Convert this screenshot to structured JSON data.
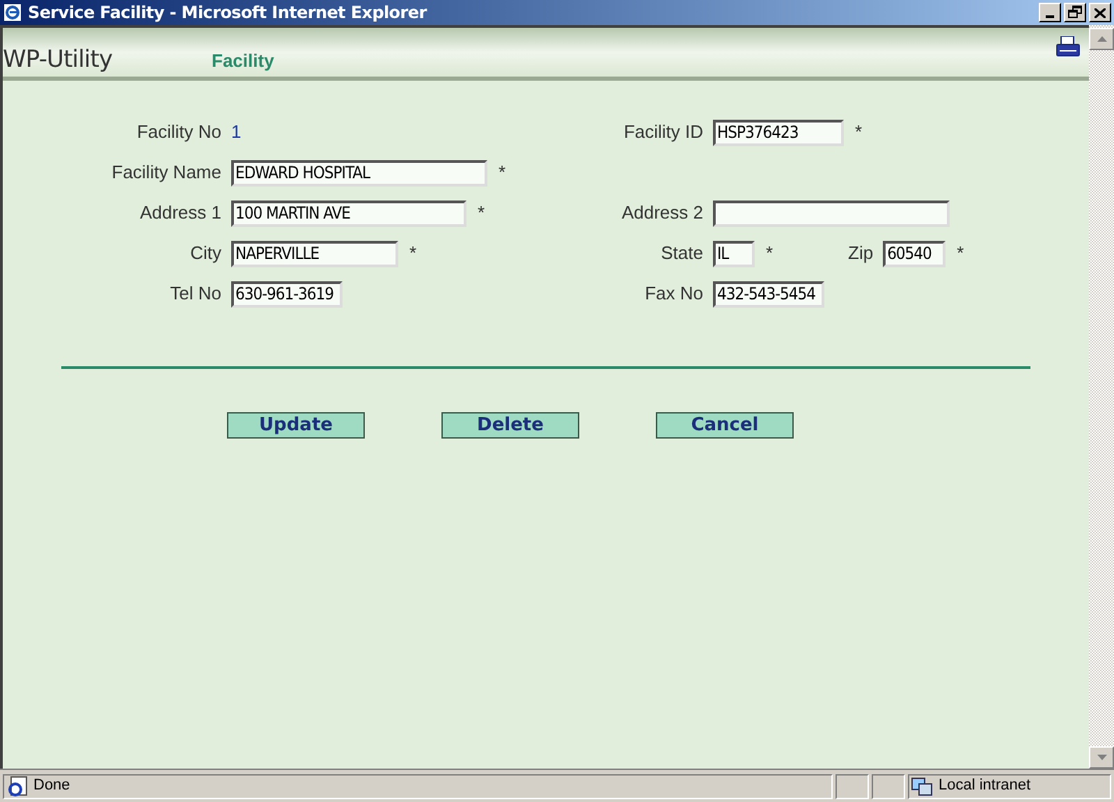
{
  "window": {
    "title": "Service Facility - Microsoft Internet Explorer"
  },
  "header": {
    "app_name": "WP-Utility",
    "page_title": "Facility"
  },
  "form": {
    "rows": [
      [
        {
          "label": "Facility No",
          "kind": "text",
          "value": "1"
        },
        {
          "label": "Facility ID",
          "kind": "input",
          "value": "HSP376423",
          "required_mark": "*"
        }
      ],
      [
        {
          "label": "Facility Name",
          "kind": "input",
          "value": "EDWARD HOSPITAL",
          "required_mark": "*"
        }
      ],
      [
        {
          "label": "Address 1",
          "kind": "input",
          "value": "100 MARTIN AVE",
          "required_mark": "*"
        },
        {
          "label": "Address 2",
          "kind": "input"
        }
      ],
      [
        {
          "label": "City",
          "kind": "input",
          "value": "NAPERVILLE",
          "required_mark": "*"
        },
        {
          "label": "State",
          "kind": "input",
          "value": "IL",
          "required_mark": "*"
        },
        {
          "label": "Zip",
          "kind": "input",
          "value": "60540",
          "required_mark": "*"
        }
      ],
      [
        {
          "label": "Tel No",
          "kind": "input",
          "value": "630-961-3619"
        },
        {
          "label": "Fax No",
          "kind": "input",
          "value": "432-543-5454"
        }
      ]
    ]
  },
  "buttons": [
    "Update",
    "Delete",
    "Cancel"
  ],
  "status_bar": {
    "status": "Done",
    "zone": "Local intranet"
  }
}
